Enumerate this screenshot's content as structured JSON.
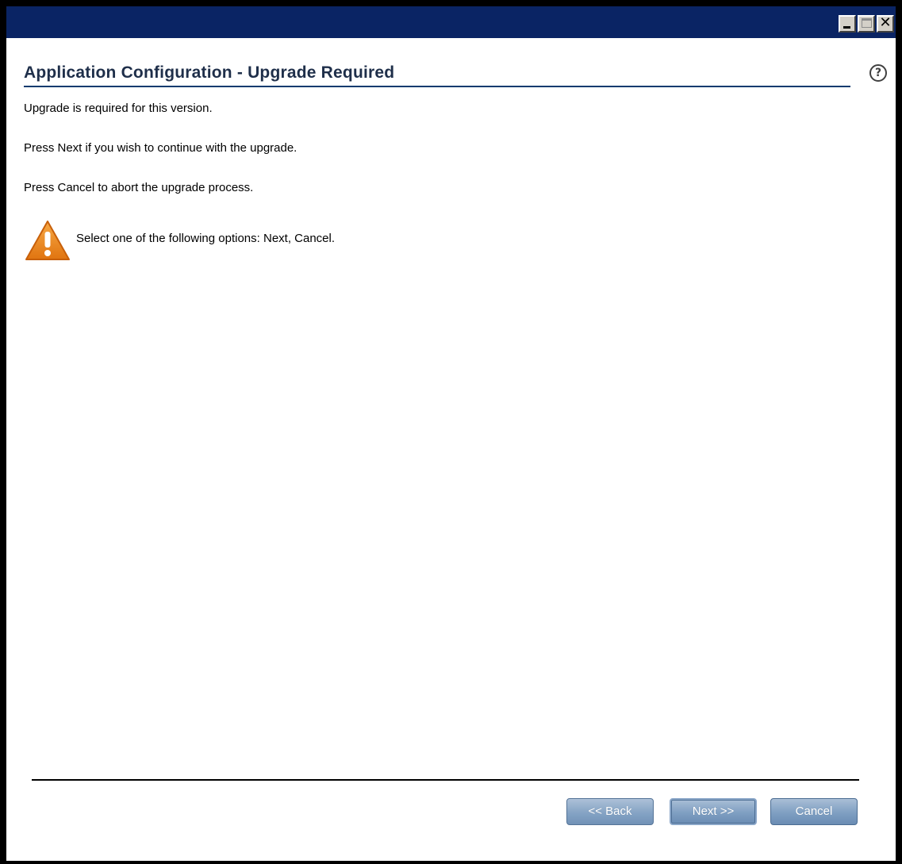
{
  "window": {
    "titlebar_color": "#0a2464"
  },
  "header": {
    "title": "Application Configuration - Upgrade Required",
    "help_glyph": "?"
  },
  "messages": {
    "line1": "Upgrade is required for this version.",
    "line2": "Press Next if you wish to continue with the upgrade.",
    "line3": "Press Cancel to abort the upgrade process."
  },
  "warning": {
    "icon": "warning-triangle-icon",
    "text": "Select one of the following options: Next, Cancel.",
    "icon_color": "#f08a1c"
  },
  "footer": {
    "back_label": "<< Back",
    "next_label": "Next >>",
    "cancel_label": "Cancel"
  }
}
